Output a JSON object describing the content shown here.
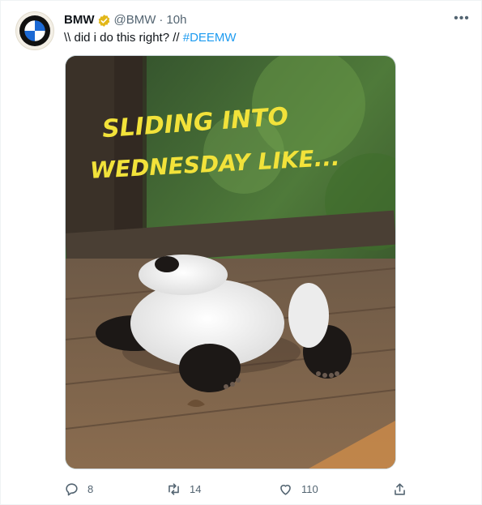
{
  "tweet": {
    "display_name": "BMW",
    "handle": "@BMW",
    "separator": "·",
    "time": "10h",
    "text_before": "\\\\ did i do this right? // ",
    "hashtag": "#DEEMW",
    "image_caption_line1": "SLIDING INTO",
    "image_caption_line2": "WEDNESDAY LIKE...",
    "more_icon": "more-horizontal-icon",
    "verified_icon": "verified-gold-badge-icon",
    "colors": {
      "link": "#1d9bf0",
      "verified_badge": "#e2b719",
      "caption": "#f2e23a",
      "muted": "#536471"
    }
  },
  "actions": {
    "replies": "8",
    "retweets": "14",
    "likes": "110",
    "icons": [
      "reply-icon",
      "retweet-icon",
      "like-icon",
      "share-icon"
    ]
  }
}
